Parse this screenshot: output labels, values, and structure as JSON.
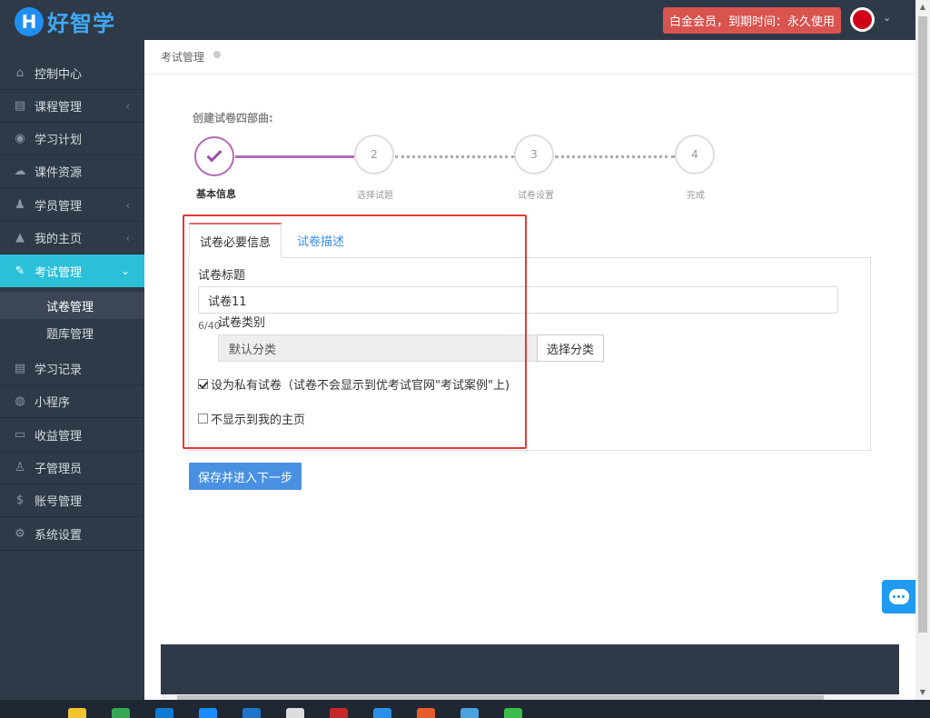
{
  "header": {
    "logo_letter": "H",
    "logo_text": "好智学",
    "member_badge": "白金会员，到期时间：永久使用",
    "avatar_caret": "⌄"
  },
  "sidebar": {
    "items": [
      {
        "label": "控制中心",
        "icon": "home-icon",
        "glyph": "⌂",
        "arrow": ""
      },
      {
        "label": "课程管理",
        "icon": "book-icon",
        "glyph": "▤",
        "arrow": "‹"
      },
      {
        "label": "学习计划",
        "icon": "eye-icon",
        "glyph": "◉",
        "arrow": ""
      },
      {
        "label": "课件资源",
        "icon": "cloud-upload-icon",
        "glyph": "☁",
        "arrow": ""
      },
      {
        "label": "学员管理",
        "icon": "users-icon",
        "glyph": "♟",
        "arrow": "‹"
      },
      {
        "label": "我的主页",
        "icon": "graduation-cap-icon",
        "glyph": "▲",
        "arrow": "‹"
      },
      {
        "label": "考试管理",
        "icon": "tag-icon",
        "glyph": "✎",
        "arrow": "⌄"
      },
      {
        "label": "学习记录",
        "icon": "book-icon",
        "glyph": "▤",
        "arrow": ""
      },
      {
        "label": "小程序",
        "icon": "wechat-icon",
        "glyph": "◍",
        "arrow": ""
      },
      {
        "label": "收益管理",
        "icon": "credit-card-icon",
        "glyph": "▭",
        "arrow": ""
      },
      {
        "label": "子管理员",
        "icon": "user-secret-icon",
        "glyph": "♙",
        "arrow": ""
      },
      {
        "label": "账号管理",
        "icon": "dollar-icon",
        "glyph": "$",
        "arrow": ""
      },
      {
        "label": "系统设置",
        "icon": "gear-icon",
        "glyph": "⚙",
        "arrow": ""
      }
    ],
    "sub_items": [
      "试卷管理",
      "题库管理"
    ]
  },
  "breadcrumb": {
    "label": "考试管理"
  },
  "steps": {
    "title": "创建试卷四部曲:",
    "items": [
      {
        "number": "",
        "label": "基本信息"
      },
      {
        "number": "2",
        "label": "选择试题"
      },
      {
        "number": "3",
        "label": "试卷设置"
      },
      {
        "number": "4",
        "label": "完成"
      }
    ]
  },
  "tabs": [
    "试卷必要信息",
    "试卷描述"
  ],
  "form": {
    "title_label": "试卷标题",
    "title_value": "试卷11",
    "counter": "6/40",
    "category_label": "试卷类别",
    "category_value": "默认分类",
    "category_button": "选择分类",
    "private_label": "设为私有试卷（试卷不会显示到优考试官网\"考试案例\"上)",
    "private_checked": true,
    "hide_label": "不显示到我的主页",
    "hide_checked": false
  },
  "actions": {
    "save_next": "保存并进入下一步"
  },
  "colors": {
    "sidebar_bg": "#2f3a48",
    "active_item": "#2bc0d8",
    "badge_red": "#d9534f",
    "primary_blue": "#4a90e2",
    "step_purple": "#b36ab8",
    "highlight_red": "#e53935"
  },
  "taskbar": {
    "icons": [
      "file-explorer-icon",
      "chrome-icon",
      "edge-icon",
      "send-icon",
      "browser-icon",
      "settings-icon",
      "wps-icon",
      "cloud-drive-icon",
      "office-icon",
      "folder-icon",
      "wechat-icon"
    ]
  }
}
